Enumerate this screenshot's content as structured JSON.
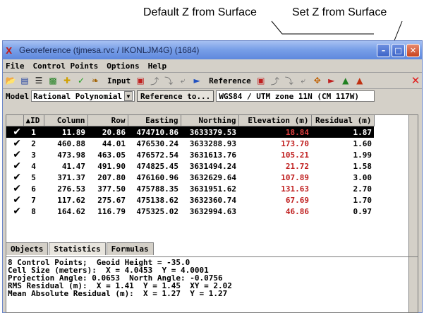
{
  "callouts": {
    "default_z": "Default Z from Surface",
    "set_z": "Set Z from Surface"
  },
  "window": {
    "title": "Georeference (tjmesa.rvc / IKONLJM4G) (1684)",
    "buttons": [
      "minimize",
      "maximize",
      "close"
    ]
  },
  "menu": [
    "File",
    "Control Points",
    "Options",
    "Help"
  ],
  "toolbar": {
    "input_label": "Input",
    "reference_label": "Reference"
  },
  "model": {
    "label": "Model",
    "selected": "Rational Polynomial",
    "reference_button": "Reference to...",
    "crs": "WGS84 / UTM zone 11N (CM 117W)"
  },
  "table": {
    "columns": [
      "▲ID",
      "Column",
      "Row",
      "Easting",
      "Northing",
      "Elevation (m)",
      "Residual (m)"
    ],
    "rows": [
      {
        "id": "1",
        "column": "11.89",
        "row": "20.86",
        "easting": "474710.86",
        "northing": "3633379.53",
        "elevation": "18.84",
        "residual": "1.87",
        "selected": true
      },
      {
        "id": "2",
        "column": "460.88",
        "row": "44.01",
        "easting": "476530.24",
        "northing": "3633288.93",
        "elevation": "173.70",
        "residual": "1.60"
      },
      {
        "id": "3",
        "column": "473.98",
        "row": "463.05",
        "easting": "476572.54",
        "northing": "3631613.76",
        "elevation": "105.21",
        "residual": "1.99"
      },
      {
        "id": "4",
        "column": "41.47",
        "row": "491.90",
        "easting": "474825.45",
        "northing": "3631494.24",
        "elevation": "21.72",
        "residual": "1.58"
      },
      {
        "id": "5",
        "column": "371.37",
        "row": "207.80",
        "easting": "476160.96",
        "northing": "3632629.64",
        "elevation": "107.89",
        "residual": "3.00"
      },
      {
        "id": "6",
        "column": "276.53",
        "row": "377.50",
        "easting": "475788.35",
        "northing": "3631951.62",
        "elevation": "131.63",
        "residual": "2.70"
      },
      {
        "id": "7",
        "column": "117.62",
        "row": "275.67",
        "easting": "475138.62",
        "northing": "3632360.74",
        "elevation": "67.69",
        "residual": "1.70"
      },
      {
        "id": "8",
        "column": "164.62",
        "row": "116.79",
        "easting": "475325.02",
        "northing": "3632994.63",
        "elevation": "46.86",
        "residual": "0.97"
      }
    ]
  },
  "tabs": [
    "Objects",
    "Statistics",
    "Formulas"
  ],
  "statistics": [
    "8 Control Points;  Geoid Height = -35.0",
    "Cell Size (meters):  X = 4.0453  Y = 4.0001",
    "Projection Angle: 0.0653  North Angle: -0.0756",
    "RMS Residual (m):  X = 1.41  Y = 1.45  XY = 2.02",
    "Mean Absolute Residual (m):  X = 1.27  Y = 1.27"
  ],
  "colors": {
    "title_gradient_top": "#a7c1f2",
    "title_gradient_bottom": "#5e88dd",
    "elevation_text": "#c02020",
    "selected_row_bg": "#000000"
  }
}
